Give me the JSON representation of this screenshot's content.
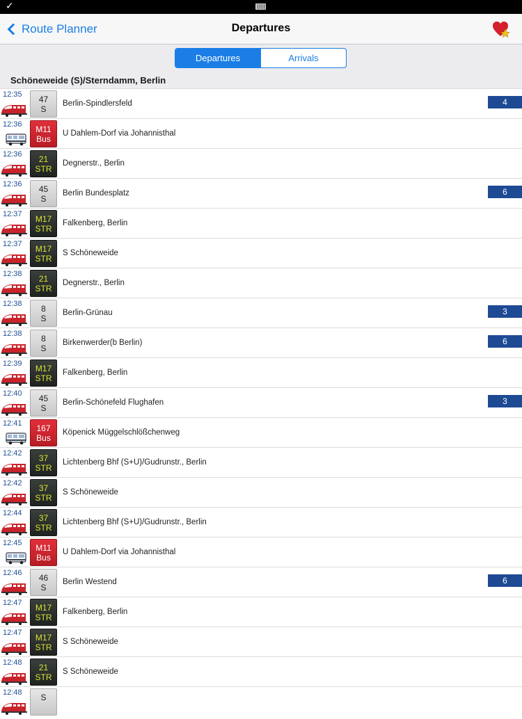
{
  "status_bar": {
    "left_icon": "checkmark-icon",
    "center_icon": "keyboard-icon"
  },
  "nav": {
    "back_label": "Route Planner",
    "title": "Departures",
    "favorite_icon": "heart-star-icon"
  },
  "segments": {
    "departures": "Departures",
    "arrivals": "Arrivals",
    "selected": "Departures"
  },
  "stop_name": "Schöneweide (S)/Sterndamm, Berlin",
  "colors": {
    "accent": "#1a7ee6",
    "platform": "#1e4a94",
    "bus": "#c8232b",
    "tram_text": "#d8e236"
  },
  "departures": [
    {
      "time": "12:35",
      "line": "47",
      "type": "S",
      "dest": "Berlin-Spindlersfeld",
      "platform": "4"
    },
    {
      "time": "12:36",
      "line": "M11",
      "type": "Bus",
      "dest": "U Dahlem-Dorf via Johannisthal",
      "platform": ""
    },
    {
      "time": "12:36",
      "line": "21",
      "type": "STR",
      "dest": "Degnerstr., Berlin",
      "platform": ""
    },
    {
      "time": "12:36",
      "line": "45",
      "type": "S",
      "dest": "Berlin Bundesplatz",
      "platform": "6"
    },
    {
      "time": "12:37",
      "line": "M17",
      "type": "STR",
      "dest": "Falkenberg, Berlin",
      "platform": ""
    },
    {
      "time": "12:37",
      "line": "M17",
      "type": "STR",
      "dest": "S Schöneweide",
      "platform": ""
    },
    {
      "time": "12:38",
      "line": "21",
      "type": "STR",
      "dest": "Degnerstr., Berlin",
      "platform": ""
    },
    {
      "time": "12:38",
      "line": "8",
      "type": "S",
      "dest": "Berlin-Grünau",
      "platform": "3"
    },
    {
      "time": "12:38",
      "line": "8",
      "type": "S",
      "dest": "Birkenwerder(b Berlin)",
      "platform": "6"
    },
    {
      "time": "12:39",
      "line": "M17",
      "type": "STR",
      "dest": "Falkenberg, Berlin",
      "platform": ""
    },
    {
      "time": "12:40",
      "line": "45",
      "type": "S",
      "dest": "Berlin-Schönefeld Flughafen",
      "platform": "3"
    },
    {
      "time": "12:41",
      "line": "167",
      "type": "Bus",
      "dest": "Köpenick Müggelschlößchenweg",
      "platform": ""
    },
    {
      "time": "12:42",
      "line": "37",
      "type": "STR",
      "dest": "Lichtenberg Bhf (S+U)/Gudrunstr., Berlin",
      "platform": ""
    },
    {
      "time": "12:42",
      "line": "37",
      "type": "STR",
      "dest": "S Schöneweide",
      "platform": ""
    },
    {
      "time": "12:44",
      "line": "37",
      "type": "STR",
      "dest": "Lichtenberg Bhf (S+U)/Gudrunstr., Berlin",
      "platform": ""
    },
    {
      "time": "12:45",
      "line": "M11",
      "type": "Bus",
      "dest": "U Dahlem-Dorf via Johannisthal",
      "platform": ""
    },
    {
      "time": "12:46",
      "line": "46",
      "type": "S",
      "dest": "Berlin Westend",
      "platform": "6"
    },
    {
      "time": "12:47",
      "line": "M17",
      "type": "STR",
      "dest": "Falkenberg, Berlin",
      "platform": ""
    },
    {
      "time": "12:47",
      "line": "M17",
      "type": "STR",
      "dest": "S Schöneweide",
      "platform": ""
    },
    {
      "time": "12:48",
      "line": "21",
      "type": "STR",
      "dest": "S Schöneweide",
      "platform": ""
    },
    {
      "time": "12:48",
      "line": "",
      "type": "S",
      "dest": "",
      "platform": ""
    }
  ]
}
